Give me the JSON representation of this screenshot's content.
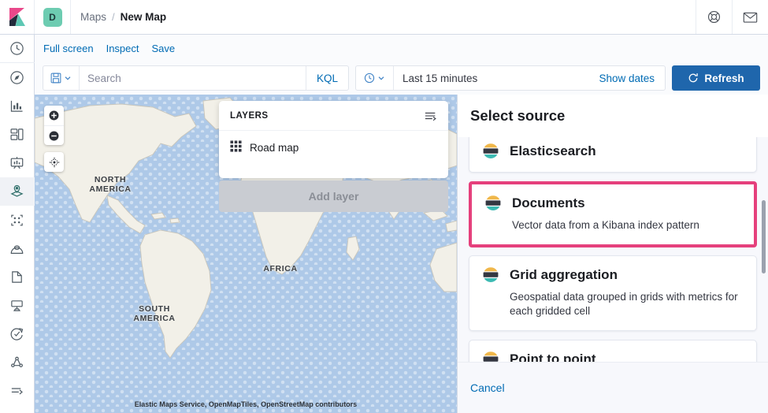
{
  "header": {
    "logo_icon": "kibana-logo",
    "space_badge": "D",
    "breadcrumbs": [
      {
        "label": "Maps",
        "current": false
      },
      {
        "label": "New Map",
        "current": true
      }
    ],
    "separator": "/",
    "right_icons": [
      {
        "name": "help-icon",
        "glyph": "help"
      },
      {
        "name": "mail-icon",
        "glyph": "mail"
      }
    ]
  },
  "sidebar": {
    "items": [
      {
        "name": "recently-viewed",
        "icon": "clock-icon"
      },
      {
        "name": "discover",
        "icon": "compass-icon"
      },
      {
        "name": "visualize",
        "icon": "bar-chart-icon"
      },
      {
        "name": "dashboard",
        "icon": "dashboard-icon"
      },
      {
        "name": "canvas",
        "icon": "presentation-icon"
      },
      {
        "name": "maps",
        "icon": "map-marker-icon",
        "active": true
      },
      {
        "name": "machine-learning",
        "icon": "ml-nodes-icon"
      },
      {
        "name": "infrastructure",
        "icon": "infra-icon"
      },
      {
        "name": "logs",
        "icon": "logs-icon"
      },
      {
        "name": "apm",
        "icon": "apm-icon"
      },
      {
        "name": "uptime",
        "icon": "uptime-icon"
      },
      {
        "name": "siem",
        "icon": "siem-icon"
      },
      {
        "name": "collapse-nav",
        "icon": "arrow-right-icon"
      }
    ]
  },
  "nav_strip": {
    "links": [
      {
        "label": "Full screen"
      },
      {
        "label": "Inspect"
      },
      {
        "label": "Save"
      }
    ]
  },
  "query_bar": {
    "saved_query_icon": "saved-query-icon",
    "chevron_icon": "chevron-down-icon",
    "search_placeholder": "Search",
    "search_value": "",
    "language_badge": "KQL",
    "time_icon": "clock-icon",
    "time_range": "Last 15 minutes",
    "show_dates_label": "Show dates",
    "refresh_label": "Refresh",
    "refresh_icon": "refresh-icon",
    "refresh_color": "#1f66ac"
  },
  "map": {
    "zoom_in_icon": "plus-icon",
    "zoom_out_icon": "minus-icon",
    "locate_icon": "crosshair-icon",
    "labels": [
      {
        "text": "NORTH\nAMERICA",
        "name": "map-label-north-america"
      },
      {
        "text": "SOUTH\nAMERICA",
        "name": "map-label-south-america"
      },
      {
        "text": "AFRICA",
        "name": "map-label-africa"
      }
    ],
    "label_north_america": "NORTH",
    "label_north_america2": "AMERICA",
    "label_south_america": "SOUTH",
    "label_south_america2": "AMERICA",
    "label_africa": "AFRICA",
    "attribution": "Elastic Maps Service, OpenMapTiles, OpenStreetMap contributors",
    "ocean_color": "#aec9e8",
    "land_color": "#f2f0e8"
  },
  "layers_panel": {
    "title": "LAYERS",
    "sort_icon": "sort-list-icon",
    "layers": [
      {
        "name": "Road map",
        "icon": "grid-tile-icon"
      }
    ],
    "add_layer_label": "Add layer",
    "add_layer_disabled": true
  },
  "flyout": {
    "title": "Select source",
    "sources": [
      {
        "title": "Elasticsearch",
        "description": "",
        "icon": "elastic-logo-icon",
        "clipped": true,
        "highlighted": false
      },
      {
        "title": "Documents",
        "description": "Vector data from a Kibana index pattern",
        "icon": "elastic-logo-icon",
        "clipped": false,
        "highlighted": true
      },
      {
        "title": "Grid aggregation",
        "description": "Geospatial data grouped in grids with metrics for each gridded cell",
        "icon": "elastic-logo-icon",
        "clipped": false,
        "highlighted": false
      },
      {
        "title": "Point to point",
        "description": "",
        "icon": "elastic-logo-icon",
        "clipped": false,
        "highlighted": false
      }
    ],
    "highlight_color": "#e5407c",
    "cancel_label": "Cancel"
  }
}
